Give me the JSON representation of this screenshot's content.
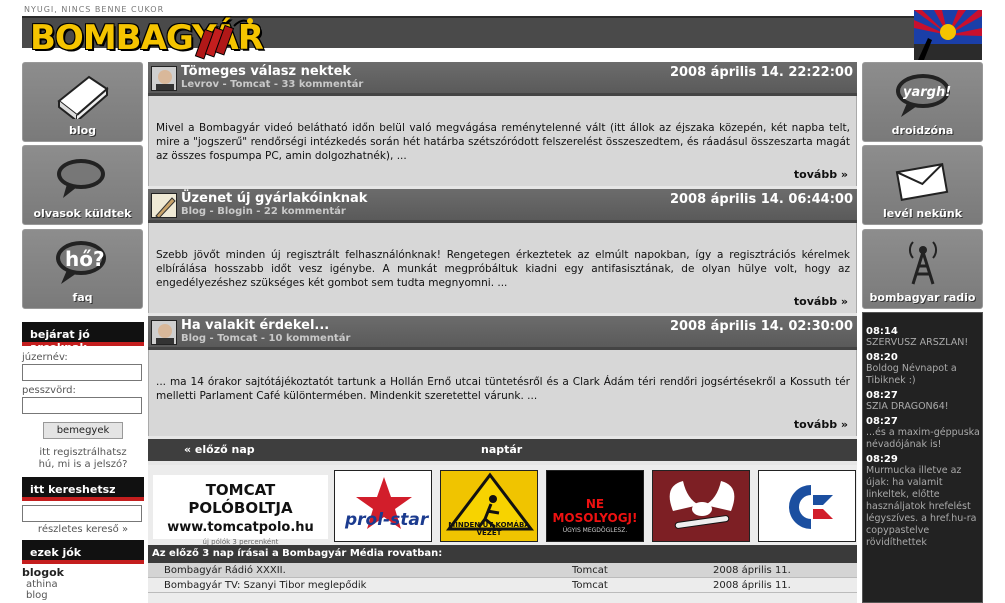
{
  "header": {
    "tagline": "NYUGI, NINCS BENNE CUKOR",
    "logo_text": "BOMBAGYÁR"
  },
  "left_nav": [
    {
      "label": "blog",
      "icon": "book-icon"
    },
    {
      "label": "olvasok küldtek",
      "icon": "speech-bubble-icon"
    },
    {
      "label": "faq",
      "icon": "question-bubble-icon"
    }
  ],
  "right_nav": [
    {
      "label": "droidzóna",
      "icon": "yargh-bubble-icon",
      "icon_text": "yargh!"
    },
    {
      "label": "levél nekünk",
      "icon": "envelope-icon"
    },
    {
      "label": "bombagyar radio",
      "icon": "radio-tower-icon"
    }
  ],
  "login": {
    "title": "bejárat jó arcoknak",
    "user_label": "júzernév:",
    "pass_label": "pesszvörd:",
    "button": "bemegyek",
    "link1": "itt regisztrálhatsz",
    "link2": "hú, mi is a jelszó?"
  },
  "search": {
    "title": "itt kereshetsz",
    "link": "részletes kereső »"
  },
  "these": {
    "title": "ezek jók",
    "heading": "blogok",
    "items": [
      "athina",
      "blog"
    ]
  },
  "posts": [
    {
      "title": "Tömeges válasz nektek",
      "meta": "Levrov - Tomcat - 33 kommentár",
      "date": "2008 április 14. 22:22:00",
      "body": "Mivel a Bombagyár videó belátható időn belül való megvágása reménytelenné vált (itt állok az éjszaka közepén, két napba telt, mire a \"jogszerű\" rendőrségi intézkedés során hét határba szétszóródott felszerelést összeszedtem, és ráadásul összeszarta magát az összes fospumpa PC, amin dolgozhatnék), ...",
      "more": "tovább »"
    },
    {
      "title": "Üzenet új gyárlakóinknak",
      "meta": "Blog - Blogin - 22 kommentár",
      "date": "2008 április 14. 06:44:00",
      "body": "Szebb jövőt minden új regisztrált felhasználónknak! Rengetegen érkeztetek az elmúlt napokban, így a regisztrációs kérelmek elbírálása hosszabb időt vesz igénybe. A munkát megpróbáltuk kiadni egy antifasisztának, de olyan hülye volt, hogy az engedélyezéshez szükséges két gombot sem tudta megnyomni. ...",
      "more": "tovább »"
    },
    {
      "title": "Ha valakit érdekel...",
      "meta": "Blog - Tomcat - 10 kommentár",
      "date": "2008 április 14. 02:30:00",
      "body": "... ma 14 órakor sajtótájékoztatót tartunk a Hollán Ernő utcai tüntetésről és a Clark Ádám téri rendőri jogsértésekről a Kossuth tér melletti Parlament Café különtermében. Mindenkit szeretettel várunk. ...",
      "more": "tovább »"
    }
  ],
  "pager": {
    "prev": "« előző nap",
    "calendar": "naptár"
  },
  "banners": {
    "tomcat_title": "TOMCAT POLÓBOLTJA",
    "tomcat_url": "www.tomcatpolo.hu",
    "tomcat_sub": "új pólók 3 percenként",
    "prolstar": "prol-star",
    "warning_text": "MINDEN ÚT KOMÁBA VEZET",
    "nemosolyog": "NE MOSOLYOGJ!",
    "nemosolyog_sub": "ÚGYIS MEGDÖGLESZ."
  },
  "recent": {
    "heading": "Az előző 3 nap írásai a Bombagyár Média rovatban:",
    "rows": [
      {
        "title": "Bombagyár Rádió XXXII.",
        "author": "Tomcat",
        "date": "2008 április 11."
      },
      {
        "title": "Bombagyár TV: Szanyi Tibor meglepődik",
        "author": "Tomcat",
        "date": "2008 április 11."
      }
    ]
  },
  "chat": [
    {
      "time": "08:14",
      "msg": "SZERVUSZ ARSZLAN!"
    },
    {
      "time": "08:20",
      "msg": "Boldog Névnapot a Tibiknek :)"
    },
    {
      "time": "08:27",
      "msg": "SZIA DRAGON64!"
    },
    {
      "time": "08:27",
      "msg": "...és a maxim-géppuska névadójának is!"
    },
    {
      "time": "08:29",
      "msg": "Murmucka illetve az újak: ha valamit linkeltek, előtte használjatok hrefelést légyszíves. a href.hu-ra copypastelve rövidíthettek"
    }
  ],
  "colors": {
    "accent_red": "#c41e1e",
    "logo_yellow": "#f5c400",
    "tile_grey": "#8d8d8d"
  }
}
